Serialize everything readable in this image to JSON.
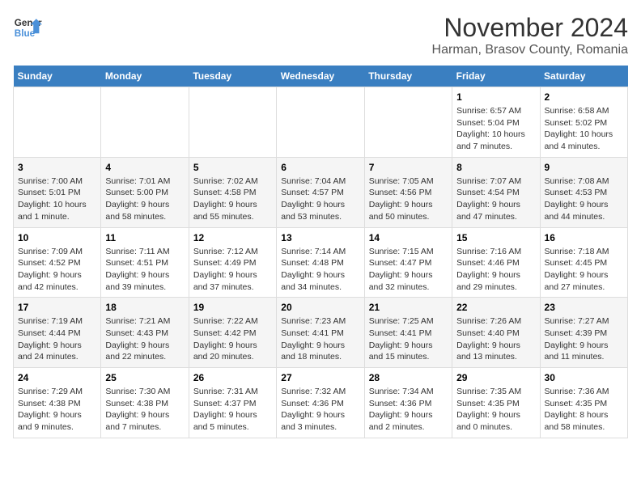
{
  "header": {
    "logo_line1": "General",
    "logo_line2": "Blue",
    "month": "November 2024",
    "location": "Harman, Brasov County, Romania"
  },
  "weekdays": [
    "Sunday",
    "Monday",
    "Tuesday",
    "Wednesday",
    "Thursday",
    "Friday",
    "Saturday"
  ],
  "weeks": [
    [
      {
        "day": "",
        "info": ""
      },
      {
        "day": "",
        "info": ""
      },
      {
        "day": "",
        "info": ""
      },
      {
        "day": "",
        "info": ""
      },
      {
        "day": "",
        "info": ""
      },
      {
        "day": "1",
        "info": "Sunrise: 6:57 AM\nSunset: 5:04 PM\nDaylight: 10 hours and 7 minutes."
      },
      {
        "day": "2",
        "info": "Sunrise: 6:58 AM\nSunset: 5:02 PM\nDaylight: 10 hours and 4 minutes."
      }
    ],
    [
      {
        "day": "3",
        "info": "Sunrise: 7:00 AM\nSunset: 5:01 PM\nDaylight: 10 hours and 1 minute."
      },
      {
        "day": "4",
        "info": "Sunrise: 7:01 AM\nSunset: 5:00 PM\nDaylight: 9 hours and 58 minutes."
      },
      {
        "day": "5",
        "info": "Sunrise: 7:02 AM\nSunset: 4:58 PM\nDaylight: 9 hours and 55 minutes."
      },
      {
        "day": "6",
        "info": "Sunrise: 7:04 AM\nSunset: 4:57 PM\nDaylight: 9 hours and 53 minutes."
      },
      {
        "day": "7",
        "info": "Sunrise: 7:05 AM\nSunset: 4:56 PM\nDaylight: 9 hours and 50 minutes."
      },
      {
        "day": "8",
        "info": "Sunrise: 7:07 AM\nSunset: 4:54 PM\nDaylight: 9 hours and 47 minutes."
      },
      {
        "day": "9",
        "info": "Sunrise: 7:08 AM\nSunset: 4:53 PM\nDaylight: 9 hours and 44 minutes."
      }
    ],
    [
      {
        "day": "10",
        "info": "Sunrise: 7:09 AM\nSunset: 4:52 PM\nDaylight: 9 hours and 42 minutes."
      },
      {
        "day": "11",
        "info": "Sunrise: 7:11 AM\nSunset: 4:51 PM\nDaylight: 9 hours and 39 minutes."
      },
      {
        "day": "12",
        "info": "Sunrise: 7:12 AM\nSunset: 4:49 PM\nDaylight: 9 hours and 37 minutes."
      },
      {
        "day": "13",
        "info": "Sunrise: 7:14 AM\nSunset: 4:48 PM\nDaylight: 9 hours and 34 minutes."
      },
      {
        "day": "14",
        "info": "Sunrise: 7:15 AM\nSunset: 4:47 PM\nDaylight: 9 hours and 32 minutes."
      },
      {
        "day": "15",
        "info": "Sunrise: 7:16 AM\nSunset: 4:46 PM\nDaylight: 9 hours and 29 minutes."
      },
      {
        "day": "16",
        "info": "Sunrise: 7:18 AM\nSunset: 4:45 PM\nDaylight: 9 hours and 27 minutes."
      }
    ],
    [
      {
        "day": "17",
        "info": "Sunrise: 7:19 AM\nSunset: 4:44 PM\nDaylight: 9 hours and 24 minutes."
      },
      {
        "day": "18",
        "info": "Sunrise: 7:21 AM\nSunset: 4:43 PM\nDaylight: 9 hours and 22 minutes."
      },
      {
        "day": "19",
        "info": "Sunrise: 7:22 AM\nSunset: 4:42 PM\nDaylight: 9 hours and 20 minutes."
      },
      {
        "day": "20",
        "info": "Sunrise: 7:23 AM\nSunset: 4:41 PM\nDaylight: 9 hours and 18 minutes."
      },
      {
        "day": "21",
        "info": "Sunrise: 7:25 AM\nSunset: 4:41 PM\nDaylight: 9 hours and 15 minutes."
      },
      {
        "day": "22",
        "info": "Sunrise: 7:26 AM\nSunset: 4:40 PM\nDaylight: 9 hours and 13 minutes."
      },
      {
        "day": "23",
        "info": "Sunrise: 7:27 AM\nSunset: 4:39 PM\nDaylight: 9 hours and 11 minutes."
      }
    ],
    [
      {
        "day": "24",
        "info": "Sunrise: 7:29 AM\nSunset: 4:38 PM\nDaylight: 9 hours and 9 minutes."
      },
      {
        "day": "25",
        "info": "Sunrise: 7:30 AM\nSunset: 4:38 PM\nDaylight: 9 hours and 7 minutes."
      },
      {
        "day": "26",
        "info": "Sunrise: 7:31 AM\nSunset: 4:37 PM\nDaylight: 9 hours and 5 minutes."
      },
      {
        "day": "27",
        "info": "Sunrise: 7:32 AM\nSunset: 4:36 PM\nDaylight: 9 hours and 3 minutes."
      },
      {
        "day": "28",
        "info": "Sunrise: 7:34 AM\nSunset: 4:36 PM\nDaylight: 9 hours and 2 minutes."
      },
      {
        "day": "29",
        "info": "Sunrise: 7:35 AM\nSunset: 4:35 PM\nDaylight: 9 hours and 0 minutes."
      },
      {
        "day": "30",
        "info": "Sunrise: 7:36 AM\nSunset: 4:35 PM\nDaylight: 8 hours and 58 minutes."
      }
    ]
  ]
}
